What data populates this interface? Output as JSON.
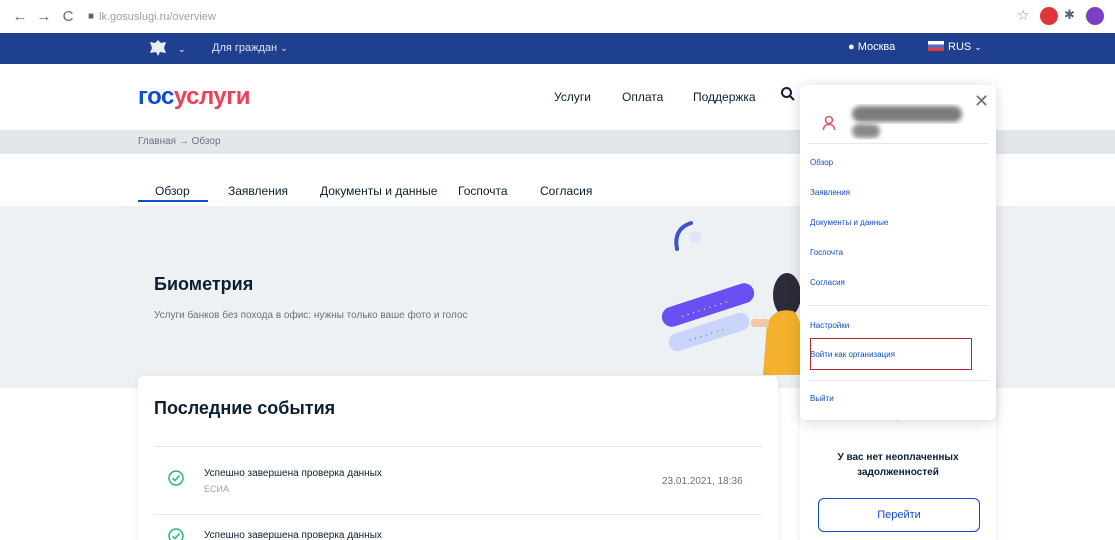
{
  "browser": {
    "url": "lk.gosuslugi.ru/overview",
    "back_glyph": "←",
    "forward_glyph": "→",
    "reload_glyph": "C"
  },
  "gov_bar": {
    "for_citizens": "Для граждан",
    "city": "Москва",
    "language": "RUS"
  },
  "header": {
    "logo_part1": "гос",
    "logo_part2": "услуги",
    "nav": [
      "Услуги",
      "Оплата",
      "Поддержка"
    ]
  },
  "breadcrumb": "Главная → Обзор",
  "tabs": [
    "Обзор",
    "Заявления",
    "Документы и данные",
    "Госпочта",
    "Согласия"
  ],
  "hero": {
    "title": "Биометрия",
    "subtitle": "Услуги банков без похода в офис: нужны только ваше фото и голос"
  },
  "events": {
    "title": "Последние события",
    "items": [
      {
        "text": "Успешно завершена проверка данных",
        "sub": "ЕСИА",
        "date": "23.01.2021, 18:36"
      },
      {
        "text": "Успешно завершена проверка данных",
        "sub": "",
        "date": ""
      }
    ]
  },
  "debts": {
    "text": "У вас нет неоплаченных задолженностей",
    "button": "Перейти"
  },
  "dropdown": {
    "items": [
      "Обзор",
      "Заявления",
      "Документы и данные",
      "Госпочта",
      "Согласия"
    ],
    "settings": "Настройки",
    "login_as_org": "Войти как организация",
    "logout": "Выйти"
  },
  "colors": {
    "gov_blue": "#1f3f8f",
    "link_blue": "#0d4cd3",
    "brand_red": "#ee3f58",
    "highlight_red": "#b3262e",
    "success_green": "#2bb673"
  }
}
